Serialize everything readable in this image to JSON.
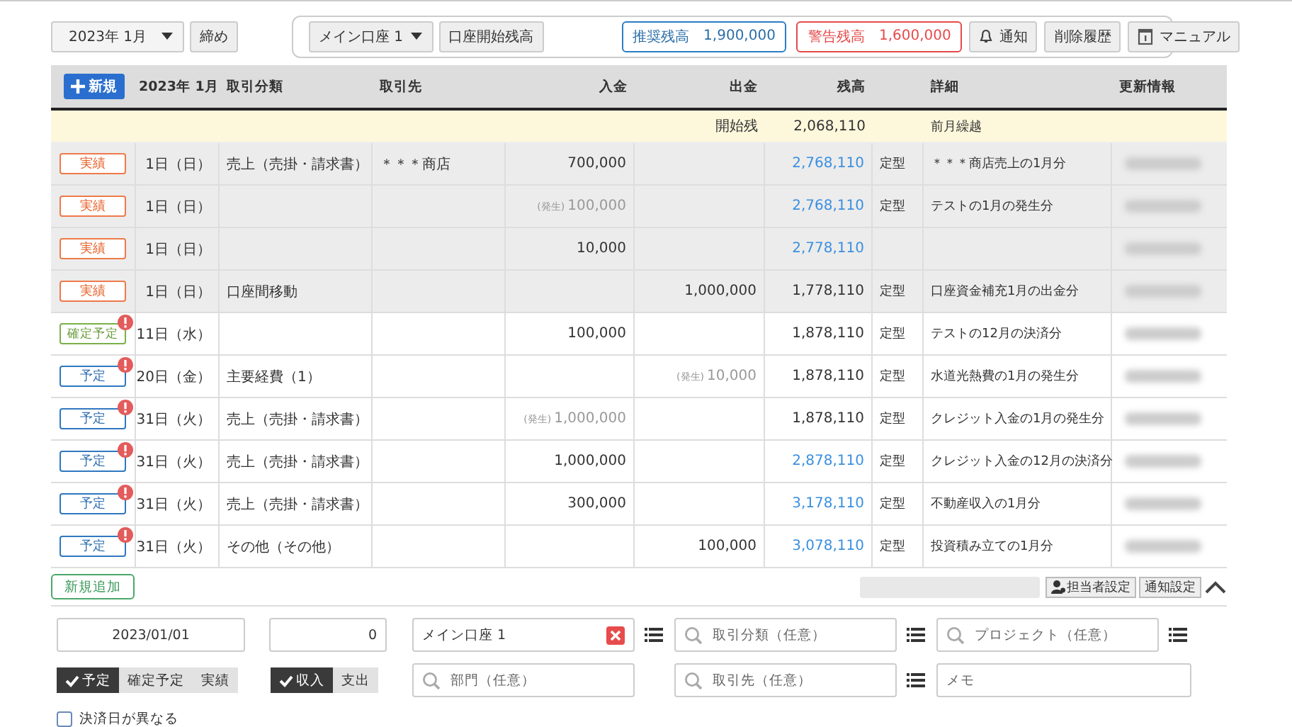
{
  "toolbar": {
    "month": "2023年 1月",
    "close_button": "締め",
    "account": "メイン口座 1",
    "opening_balance_button": "口座開始残高",
    "recommended": {
      "label": "推奨残高",
      "value": "1,900,000"
    },
    "warning": {
      "label": "警告残高",
      "value": "1,600,000"
    },
    "buttons": [
      {
        "label": "通知",
        "kind": "bell"
      },
      {
        "label": "削除履歴",
        "kind": "plain"
      },
      {
        "label": "マニュアル",
        "kind": "manual"
      }
    ]
  },
  "table": {
    "new_button": "新規",
    "columns": [
      "2023年 1月",
      "取引分類",
      "取引先",
      "入金",
      "出金",
      "残高",
      "",
      "詳細",
      "更新情報"
    ],
    "opening": {
      "label": "開始残",
      "balance": "2,068,110",
      "detail": "前月繰越"
    },
    "rows": [
      {
        "status": "実績",
        "kind": "actual",
        "alert": false,
        "date": "1日（日）",
        "category": "売上（売掛・請求書）",
        "partner": "＊＊＊商店",
        "income_note": "",
        "income": "700,000",
        "expense_note": "",
        "expense": "",
        "balance": "2,768,110",
        "balance_highlight": true,
        "type": "定型",
        "detail": "＊＊＊商店売上の1月分"
      },
      {
        "status": "実績",
        "kind": "actual",
        "alert": false,
        "date": "1日（日）",
        "category": "",
        "partner": "",
        "income_note": "(発生)",
        "income": "100,000",
        "expense_note": "",
        "expense": "",
        "balance": "2,768,110",
        "balance_highlight": true,
        "type": "定型",
        "detail": "テストの1月の発生分"
      },
      {
        "status": "実績",
        "kind": "actual",
        "alert": false,
        "date": "1日（日）",
        "category": "",
        "partner": "",
        "income_note": "",
        "income": "10,000",
        "expense_note": "",
        "expense": "",
        "balance": "2,778,110",
        "balance_highlight": true,
        "type": "",
        "detail": ""
      },
      {
        "status": "実績",
        "kind": "actual",
        "alert": false,
        "date": "1日（日）",
        "category": "口座間移動",
        "partner": "",
        "income_note": "",
        "income": "",
        "expense_note": "",
        "expense": "1,000,000",
        "balance": "1,778,110",
        "balance_highlight": false,
        "type": "定型",
        "detail": "口座資金補充1月の出金分"
      },
      {
        "status": "確定予定",
        "kind": "confirmed",
        "alert": true,
        "date": "11日（水）",
        "category": "",
        "partner": "",
        "income_note": "",
        "income": "100,000",
        "expense_note": "",
        "expense": "",
        "balance": "1,878,110",
        "balance_highlight": false,
        "type": "定型",
        "detail": "テストの12月の決済分"
      },
      {
        "status": "予定",
        "kind": "planned",
        "alert": true,
        "date": "20日（金）",
        "category": "主要経費（1）",
        "partner": "",
        "income_note": "",
        "income": "",
        "expense_note": "(発生)",
        "expense": "10,000",
        "balance": "1,878,110",
        "balance_highlight": false,
        "type": "定型",
        "detail": "水道光熱費の1月の発生分"
      },
      {
        "status": "予定",
        "kind": "planned",
        "alert": true,
        "date": "31日（火）",
        "category": "売上（売掛・請求書）",
        "partner": "",
        "income_note": "(発生)",
        "income": "1,000,000",
        "expense_note": "",
        "expense": "",
        "balance": "1,878,110",
        "balance_highlight": false,
        "type": "定型",
        "detail": "クレジット入金の1月の発生分"
      },
      {
        "status": "予定",
        "kind": "planned",
        "alert": true,
        "date": "31日（火）",
        "category": "売上（売掛・請求書）",
        "partner": "",
        "income_note": "",
        "income": "1,000,000",
        "expense_note": "",
        "expense": "",
        "balance": "2,878,110",
        "balance_highlight": true,
        "type": "定型",
        "detail": "クレジット入金の12月の決済分"
      },
      {
        "status": "予定",
        "kind": "planned",
        "alert": true,
        "date": "31日（火）",
        "category": "売上（売掛・請求書）",
        "partner": "",
        "income_note": "",
        "income": "300,000",
        "expense_note": "",
        "expense": "",
        "balance": "3,178,110",
        "balance_highlight": true,
        "type": "定型",
        "detail": "不動産収入の1月分"
      },
      {
        "status": "予定",
        "kind": "planned",
        "alert": true,
        "date": "31日（火）",
        "category": "その他（その他）",
        "partner": "",
        "income_note": "",
        "income": "",
        "expense_note": "",
        "expense": "100,000",
        "balance": "3,078,110",
        "balance_highlight": true,
        "type": "定型",
        "detail": "投資積み立ての1月分"
      }
    ]
  },
  "footer": {
    "add_button": "新規追加",
    "assignee_button": "担当者設定",
    "notify_button": "通知設定"
  },
  "form": {
    "date": "2023/01/01",
    "amount": "0",
    "account": "メイン口座 1",
    "category": {
      "placeholder": "取引分類（任意）"
    },
    "project": {
      "placeholder": "プロジェクト（任意）"
    },
    "department": {
      "placeholder": "部門（任意）"
    },
    "partner": {
      "placeholder": "取引先（任意）"
    },
    "memo": {
      "placeholder": "メモ"
    },
    "status_options": [
      {
        "label": "予定",
        "selected": true
      },
      {
        "label": "確定予定",
        "selected": false
      },
      {
        "label": "実績",
        "selected": false
      }
    ],
    "direction_options": [
      {
        "label": "収入",
        "selected": true
      },
      {
        "label": "支出",
        "selected": false
      }
    ],
    "different_settlement_date": {
      "label": "決済日が異なる",
      "checked": false
    }
  }
}
